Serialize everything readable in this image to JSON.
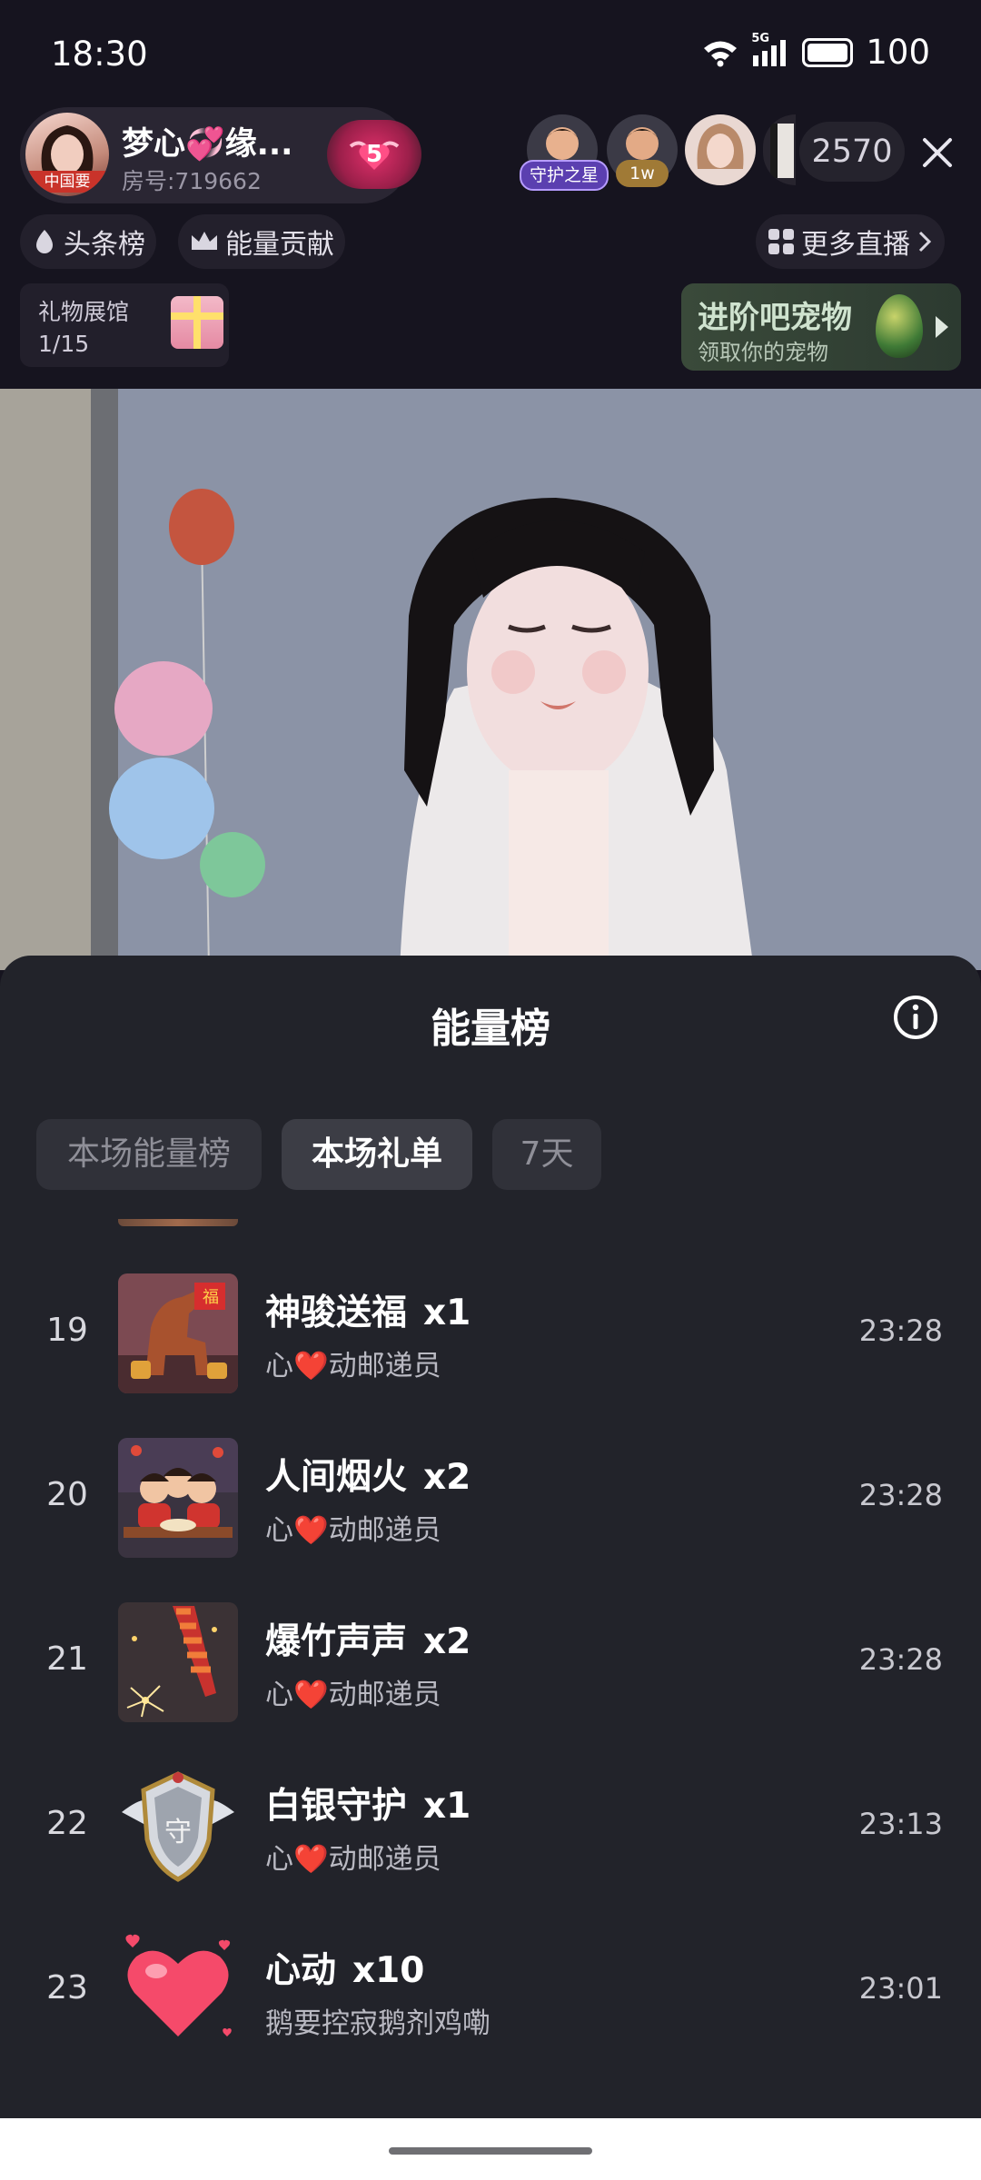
{
  "status_bar": {
    "time": "18:30",
    "network": "5G",
    "battery": "100"
  },
  "host": {
    "name": "梦心💞缘...",
    "room": "房号:719662",
    "avatar_tag": "中国要",
    "level": "5"
  },
  "viewers": {
    "tag1": "守护之星",
    "tag2": "1w",
    "count": "2570"
  },
  "chips": {
    "headlines": "头条榜",
    "energy": "能量贡献",
    "more_live": "更多直播"
  },
  "gift_hall": {
    "title": "礼物展馆",
    "progress": "1/15"
  },
  "pet_banner": {
    "title": "进阶吧宠物",
    "subtitle": "领取你的宠物"
  },
  "sheet": {
    "title": "能量榜",
    "tabs": [
      "本场能量榜",
      "本场礼单",
      "7天"
    ],
    "active_tab": "本场礼单",
    "rows": [
      {
        "rank": "19",
        "gift": "神骏送福",
        "count": "x1",
        "giver": "心❤️动邮递员",
        "time": "23:28",
        "icon": "horse-gift-icon"
      },
      {
        "rank": "20",
        "gift": "人间烟火",
        "count": "x2",
        "giver": "心❤️动邮递员",
        "time": "23:28",
        "icon": "family-dinner-gift-icon"
      },
      {
        "rank": "21",
        "gift": "爆竹声声",
        "count": "x2",
        "giver": "心❤️动邮递员",
        "time": "23:28",
        "icon": "firecracker-gift-icon"
      },
      {
        "rank": "22",
        "gift": "白银守护",
        "count": "x1",
        "giver": "心❤️动邮递员",
        "time": "23:13",
        "icon": "silver-shield-gift-icon"
      },
      {
        "rank": "23",
        "gift": "心动",
        "count": "x10",
        "giver": "鹅要控寂鹅剂鸡嘞",
        "time": "23:01",
        "icon": "heart-gift-icon"
      }
    ]
  },
  "colors": {
    "sheet_bg": "#22232a",
    "top_bg": "#16141f",
    "accent_pink": "#e0306a"
  }
}
